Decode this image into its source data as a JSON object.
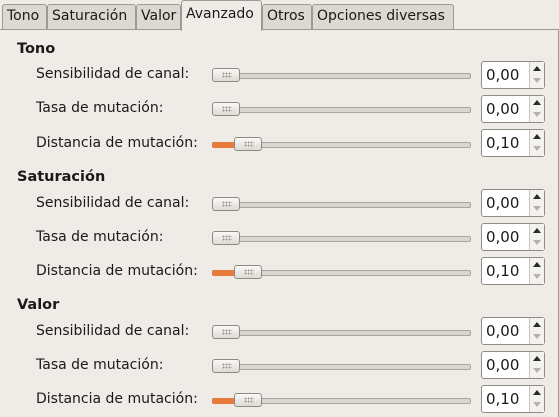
{
  "tabs": [
    {
      "label": "Tono",
      "active": false
    },
    {
      "label": "Saturación",
      "active": false
    },
    {
      "label": "Valor",
      "active": false
    },
    {
      "label": "Avanzado",
      "active": true
    },
    {
      "label": "Otros",
      "active": false
    },
    {
      "label": "Opciones diversas",
      "active": false
    }
  ],
  "sections": [
    {
      "title": "Tono",
      "rows": [
        {
          "label": "Sensibilidad de canal:",
          "value": "0,00",
          "level": 0.0
        },
        {
          "label": "Tasa de mutación:",
          "value": "0,00",
          "level": 0.0
        },
        {
          "label": "Distancia de mutación:",
          "value": "0,10",
          "level": 0.1
        }
      ]
    },
    {
      "title": "Saturación",
      "rows": [
        {
          "label": "Sensibilidad de canal:",
          "value": "0,00",
          "level": 0.0
        },
        {
          "label": "Tasa de mutación:",
          "value": "0,00",
          "level": 0.0
        },
        {
          "label": "Distancia de mutación:",
          "value": "0,10",
          "level": 0.1
        }
      ]
    },
    {
      "title": "Valor",
      "rows": [
        {
          "label": "Sensibilidad de canal:",
          "value": "0,00",
          "level": 0.0
        },
        {
          "label": "Tasa de mutación:",
          "value": "0,00",
          "level": 0.0
        },
        {
          "label": "Distancia de mutación:",
          "value": "0,10",
          "level": 0.1
        }
      ]
    }
  ],
  "colors": {
    "accent": "#e7793a",
    "background": "#efebe7"
  }
}
